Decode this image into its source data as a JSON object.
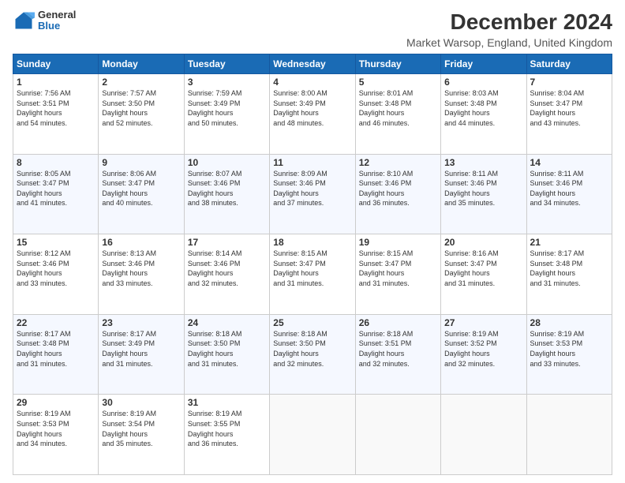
{
  "logo": {
    "general": "General",
    "blue": "Blue"
  },
  "title": "December 2024",
  "subtitle": "Market Warsop, England, United Kingdom",
  "days": [
    "Sunday",
    "Monday",
    "Tuesday",
    "Wednesday",
    "Thursday",
    "Friday",
    "Saturday"
  ],
  "weeks": [
    [
      {
        "num": "1",
        "sunrise": "7:56 AM",
        "sunset": "3:51 PM",
        "daylight": "7 hours and 54 minutes."
      },
      {
        "num": "2",
        "sunrise": "7:57 AM",
        "sunset": "3:50 PM",
        "daylight": "7 hours and 52 minutes."
      },
      {
        "num": "3",
        "sunrise": "7:59 AM",
        "sunset": "3:49 PM",
        "daylight": "7 hours and 50 minutes."
      },
      {
        "num": "4",
        "sunrise": "8:00 AM",
        "sunset": "3:49 PM",
        "daylight": "7 hours and 48 minutes."
      },
      {
        "num": "5",
        "sunrise": "8:01 AM",
        "sunset": "3:48 PM",
        "daylight": "7 hours and 46 minutes."
      },
      {
        "num": "6",
        "sunrise": "8:03 AM",
        "sunset": "3:48 PM",
        "daylight": "7 hours and 44 minutes."
      },
      {
        "num": "7",
        "sunrise": "8:04 AM",
        "sunset": "3:47 PM",
        "daylight": "7 hours and 43 minutes."
      }
    ],
    [
      {
        "num": "8",
        "sunrise": "8:05 AM",
        "sunset": "3:47 PM",
        "daylight": "7 hours and 41 minutes."
      },
      {
        "num": "9",
        "sunrise": "8:06 AM",
        "sunset": "3:47 PM",
        "daylight": "7 hours and 40 minutes."
      },
      {
        "num": "10",
        "sunrise": "8:07 AM",
        "sunset": "3:46 PM",
        "daylight": "7 hours and 38 minutes."
      },
      {
        "num": "11",
        "sunrise": "8:09 AM",
        "sunset": "3:46 PM",
        "daylight": "7 hours and 37 minutes."
      },
      {
        "num": "12",
        "sunrise": "8:10 AM",
        "sunset": "3:46 PM",
        "daylight": "7 hours and 36 minutes."
      },
      {
        "num": "13",
        "sunrise": "8:11 AM",
        "sunset": "3:46 PM",
        "daylight": "7 hours and 35 minutes."
      },
      {
        "num": "14",
        "sunrise": "8:11 AM",
        "sunset": "3:46 PM",
        "daylight": "7 hours and 34 minutes."
      }
    ],
    [
      {
        "num": "15",
        "sunrise": "8:12 AM",
        "sunset": "3:46 PM",
        "daylight": "7 hours and 33 minutes."
      },
      {
        "num": "16",
        "sunrise": "8:13 AM",
        "sunset": "3:46 PM",
        "daylight": "7 hours and 33 minutes."
      },
      {
        "num": "17",
        "sunrise": "8:14 AM",
        "sunset": "3:46 PM",
        "daylight": "7 hours and 32 minutes."
      },
      {
        "num": "18",
        "sunrise": "8:15 AM",
        "sunset": "3:47 PM",
        "daylight": "7 hours and 31 minutes."
      },
      {
        "num": "19",
        "sunrise": "8:15 AM",
        "sunset": "3:47 PM",
        "daylight": "7 hours and 31 minutes."
      },
      {
        "num": "20",
        "sunrise": "8:16 AM",
        "sunset": "3:47 PM",
        "daylight": "7 hours and 31 minutes."
      },
      {
        "num": "21",
        "sunrise": "8:17 AM",
        "sunset": "3:48 PM",
        "daylight": "7 hours and 31 minutes."
      }
    ],
    [
      {
        "num": "22",
        "sunrise": "8:17 AM",
        "sunset": "3:48 PM",
        "daylight": "7 hours and 31 minutes."
      },
      {
        "num": "23",
        "sunrise": "8:17 AM",
        "sunset": "3:49 PM",
        "daylight": "7 hours and 31 minutes."
      },
      {
        "num": "24",
        "sunrise": "8:18 AM",
        "sunset": "3:50 PM",
        "daylight": "7 hours and 31 minutes."
      },
      {
        "num": "25",
        "sunrise": "8:18 AM",
        "sunset": "3:50 PM",
        "daylight": "7 hours and 32 minutes."
      },
      {
        "num": "26",
        "sunrise": "8:18 AM",
        "sunset": "3:51 PM",
        "daylight": "7 hours and 32 minutes."
      },
      {
        "num": "27",
        "sunrise": "8:19 AM",
        "sunset": "3:52 PM",
        "daylight": "7 hours and 32 minutes."
      },
      {
        "num": "28",
        "sunrise": "8:19 AM",
        "sunset": "3:53 PM",
        "daylight": "7 hours and 33 minutes."
      }
    ],
    [
      {
        "num": "29",
        "sunrise": "8:19 AM",
        "sunset": "3:53 PM",
        "daylight": "7 hours and 34 minutes."
      },
      {
        "num": "30",
        "sunrise": "8:19 AM",
        "sunset": "3:54 PM",
        "daylight": "7 hours and 35 minutes."
      },
      {
        "num": "31",
        "sunrise": "8:19 AM",
        "sunset": "3:55 PM",
        "daylight": "7 hours and 36 minutes."
      },
      null,
      null,
      null,
      null
    ]
  ]
}
